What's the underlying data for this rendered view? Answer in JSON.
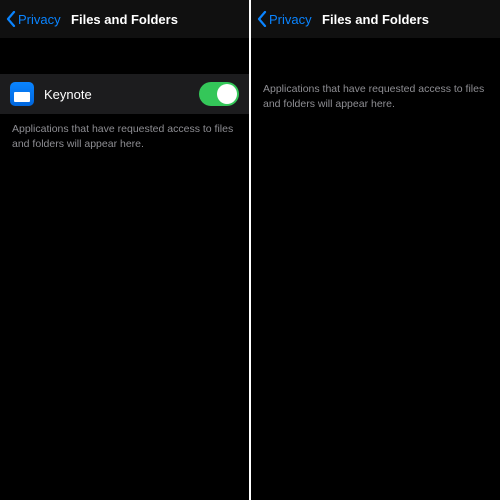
{
  "left": {
    "nav": {
      "back": "Privacy",
      "title": "Files and Folders"
    },
    "apps": [
      {
        "name": "Keynote",
        "enabled": true
      }
    ],
    "footer": "Applications that have requested access to files and folders will appear here."
  },
  "right": {
    "nav": {
      "back": "Privacy",
      "title": "Files and Folders"
    },
    "footer": "Applications that have requested access to files and folders will appear here."
  },
  "colors": {
    "accent": "#0a84ff",
    "switch_on": "#34c759"
  }
}
